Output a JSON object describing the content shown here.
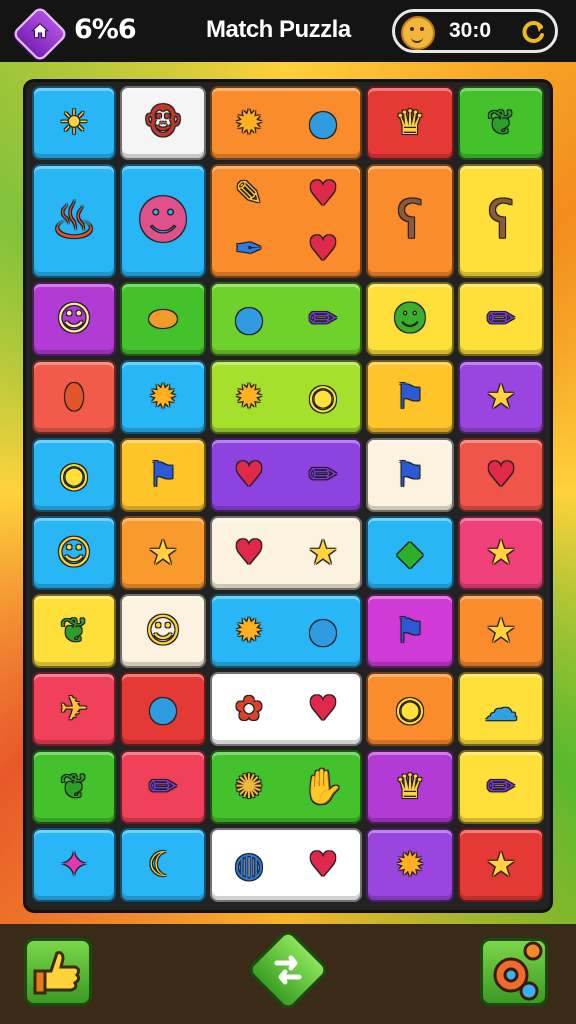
{
  "header": {
    "progress_text": "6%6",
    "title": "Match Puzzla",
    "score": "30:0",
    "colors": {
      "bar": "#141414",
      "home_button": "#9b3fd6",
      "text": "#ffffff"
    }
  },
  "board": {
    "tiles": [
      {
        "name": "tile-sun-face",
        "bg": "#29b6f6",
        "icons": [
          "sun-face-icon"
        ]
      },
      {
        "name": "tile-monkey",
        "bg": "#f5f5f5",
        "icons": [
          "monkey-icon"
        ]
      },
      {
        "name": "tile-sun-balloon",
        "bg": "#fb8c2c",
        "icons": [
          "sun-icon",
          "balloon-icon"
        ]
      },
      {
        "name": "tile-crown",
        "bg": "#e53935",
        "icons": [
          "crown-icon"
        ]
      },
      {
        "name": "tile-leaf",
        "bg": "#43c22c",
        "icons": [
          "leaf-icon"
        ]
      },
      {
        "name": "tile-flame-creature",
        "bg": "#29b6f6",
        "icons": [
          "flame-creature-icon"
        ]
      },
      {
        "name": "tile-squid",
        "bg": "#29b6f6",
        "icons": [
          "squid-icon"
        ]
      },
      {
        "name": "tile-items",
        "bg": "#fb8c2c",
        "icons": [
          "paintbrush-icon",
          "heart-icon",
          "feather-icon",
          "heart-icon"
        ]
      },
      {
        "name": "tile-bear",
        "bg": "#fb8c2c",
        "icons": [
          "bear-icon"
        ]
      },
      {
        "name": "tile-bear-2",
        "bg": "#ffe03a",
        "icons": [
          "bear-icon"
        ]
      },
      {
        "name": "tile-lion",
        "bg": "#b23bd6",
        "icons": [
          "lion-icon"
        ]
      },
      {
        "name": "tile-lemon",
        "bg": "#43c22c",
        "icons": [
          "lemon-icon"
        ]
      },
      {
        "name": "tile-balloon-pencil",
        "bg": "#6fd22c",
        "icons": [
          "balloon-icon",
          "pencil-icon"
        ]
      },
      {
        "name": "tile-frog",
        "bg": "#ffe03a",
        "icons": [
          "frog-icon"
        ]
      },
      {
        "name": "tile-pencil",
        "bg": "#ffe03a",
        "icons": [
          "pencil-icon"
        ]
      },
      {
        "name": "tile-sausage",
        "bg": "#f25a4a",
        "icons": [
          "sausage-icon"
        ]
      },
      {
        "name": "tile-sun",
        "bg": "#29b6f6",
        "icons": [
          "sun-icon"
        ]
      },
      {
        "name": "tile-sun-bubble",
        "bg": "#a5e02c",
        "icons": [
          "sun-icon",
          "speech-bubble-icon"
        ]
      },
      {
        "name": "tile-flag",
        "bg": "#ffc42a",
        "icons": [
          "flag-icon"
        ]
      },
      {
        "name": "tile-star",
        "bg": "#9b45e0",
        "icons": [
          "star-icon"
        ]
      },
      {
        "name": "tile-bubble",
        "bg": "#29b6f6",
        "icons": [
          "speech-bubble-icon"
        ]
      },
      {
        "name": "tile-flag-2",
        "bg": "#ffc42a",
        "icons": [
          "flag-icon"
        ]
      },
      {
        "name": "tile-heart-pencil",
        "bg": "#8e42e0",
        "icons": [
          "heart-icon",
          "pencil-icon"
        ]
      },
      {
        "name": "tile-flag-3",
        "bg": "#fbf3e0",
        "icons": [
          "flag-icon"
        ]
      },
      {
        "name": "tile-heart",
        "bg": "#f0554a",
        "icons": [
          "heart-icon"
        ]
      },
      {
        "name": "tile-smiley",
        "bg": "#29b6f6",
        "icons": [
          "smiley-icon"
        ]
      },
      {
        "name": "tile-star-2",
        "bg": "#fb9a2c",
        "icons": [
          "star-icon"
        ]
      },
      {
        "name": "tile-heart-star",
        "bg": "#fbf3e0",
        "icons": [
          "heart-icon",
          "star-icon"
        ]
      },
      {
        "name": "tile-crystal",
        "bg": "#29b6f6",
        "icons": [
          "crystal-icon"
        ]
      },
      {
        "name": "tile-star-3",
        "bg": "#f0407a",
        "icons": [
          "star-icon"
        ]
      },
      {
        "name": "tile-leaf-2",
        "bg": "#ffe03a",
        "icons": [
          "leaf-icon"
        ]
      },
      {
        "name": "tile-smiley-2",
        "bg": "#fbf3e0",
        "icons": [
          "smiley-icon"
        ]
      },
      {
        "name": "tile-sun-balloon-2",
        "bg": "#29b6f6",
        "icons": [
          "sun-icon",
          "balloon-icon"
        ]
      },
      {
        "name": "tile-flag-green",
        "bg": "#d03ad6",
        "icons": [
          "flag-icon"
        ]
      },
      {
        "name": "tile-star-wand",
        "bg": "#fb8c2c",
        "icons": [
          "star-icon"
        ]
      },
      {
        "name": "tile-bird",
        "bg": "#f0405a",
        "icons": [
          "bird-icon"
        ]
      },
      {
        "name": "tile-balloon",
        "bg": "#e53935",
        "icons": [
          "balloon-icon"
        ]
      },
      {
        "name": "tile-flower-heart",
        "bg": "#ffffff",
        "icons": [
          "flower-icon",
          "heart-icon"
        ]
      },
      {
        "name": "tile-bubble-2",
        "bg": "#fb8c2c",
        "icons": [
          "speech-bubble-icon"
        ]
      },
      {
        "name": "tile-cloud",
        "bg": "#ffe03a",
        "icons": [
          "cloud-icon"
        ]
      },
      {
        "name": "tile-leaf-3",
        "bg": "#43c22c",
        "icons": [
          "leaf-icon"
        ]
      },
      {
        "name": "tile-pencil-2",
        "bg": "#f0405a",
        "icons": [
          "pencil-icon"
        ]
      },
      {
        "name": "tile-cookie-mitten",
        "bg": "#43c22c",
        "icons": [
          "cookie-icon",
          "mitten-icon"
        ]
      },
      {
        "name": "tile-crown-2",
        "bg": "#b23bd6",
        "icons": [
          "crown-icon"
        ]
      },
      {
        "name": "tile-pencil-3",
        "bg": "#ffe03a",
        "icons": [
          "pencil-icon"
        ]
      },
      {
        "name": "tile-candy",
        "bg": "#29b6f6",
        "icons": [
          "candy-icon"
        ]
      },
      {
        "name": "tile-banana",
        "bg": "#29b6f6",
        "icons": [
          "banana-icon"
        ]
      },
      {
        "name": "tile-ball-heart",
        "bg": "#ffffff",
        "icons": [
          "ball-icon",
          "heart-icon"
        ]
      },
      {
        "name": "tile-sun-green",
        "bg": "#9b45e0",
        "icons": [
          "sun-icon"
        ]
      },
      {
        "name": "tile-star-green",
        "bg": "#e53935",
        "icons": [
          "star-icon"
        ]
      }
    ]
  },
  "footer": {
    "like_button": "thumbs-up-icon",
    "shuffle_button": "shuffle-icon",
    "settings_button": "gear-icon"
  }
}
